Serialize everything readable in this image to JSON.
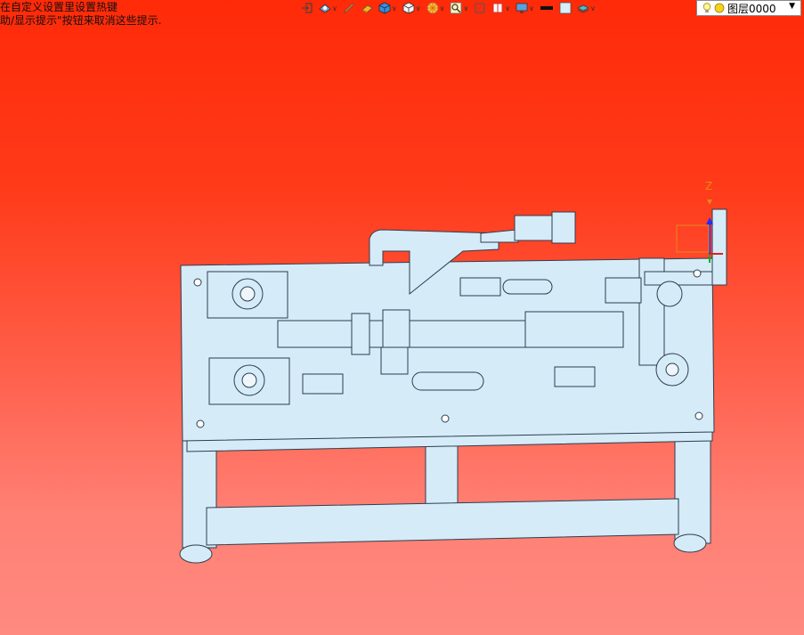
{
  "hints": {
    "line1": "在自定义设置里设置热键",
    "line2": "助/显示提示\"按钮来取消这些提示."
  },
  "toolbar": {
    "items": [
      {
        "icon": "exit-view-icon",
        "dropdown": false
      },
      {
        "icon": "render-mode-icon",
        "dropdown": true
      },
      {
        "icon": "pen-icon",
        "dropdown": false
      },
      {
        "icon": "eraser-icon",
        "dropdown": false
      },
      {
        "icon": "cube-shaded-icon",
        "dropdown": true
      },
      {
        "icon": "cube-view-icon",
        "dropdown": true
      },
      {
        "icon": "color-wheel-icon",
        "dropdown": true
      },
      {
        "icon": "zoom-icon",
        "dropdown": true
      },
      {
        "icon": "fit-view-icon",
        "dropdown": false
      },
      {
        "icon": "section-view-icon",
        "dropdown": true
      },
      {
        "icon": "monitor-icon",
        "dropdown": true
      },
      {
        "icon": "line-color-icon",
        "dropdown": false
      },
      {
        "icon": "fill-color-icon",
        "dropdown": false
      },
      {
        "icon": "layer-stack-icon",
        "dropdown": true
      }
    ]
  },
  "layer": {
    "current": "图层0000",
    "icons": [
      "bulb-icon",
      "sun-icon"
    ]
  },
  "model": {
    "axis_label": "Z",
    "colors": {
      "part_fill": "#d6ebf8",
      "part_stroke": "#2c3e50",
      "accent_blue": "#2a2aff",
      "accent_green": "#10b010",
      "accent_orange": "#e08a1a"
    }
  }
}
